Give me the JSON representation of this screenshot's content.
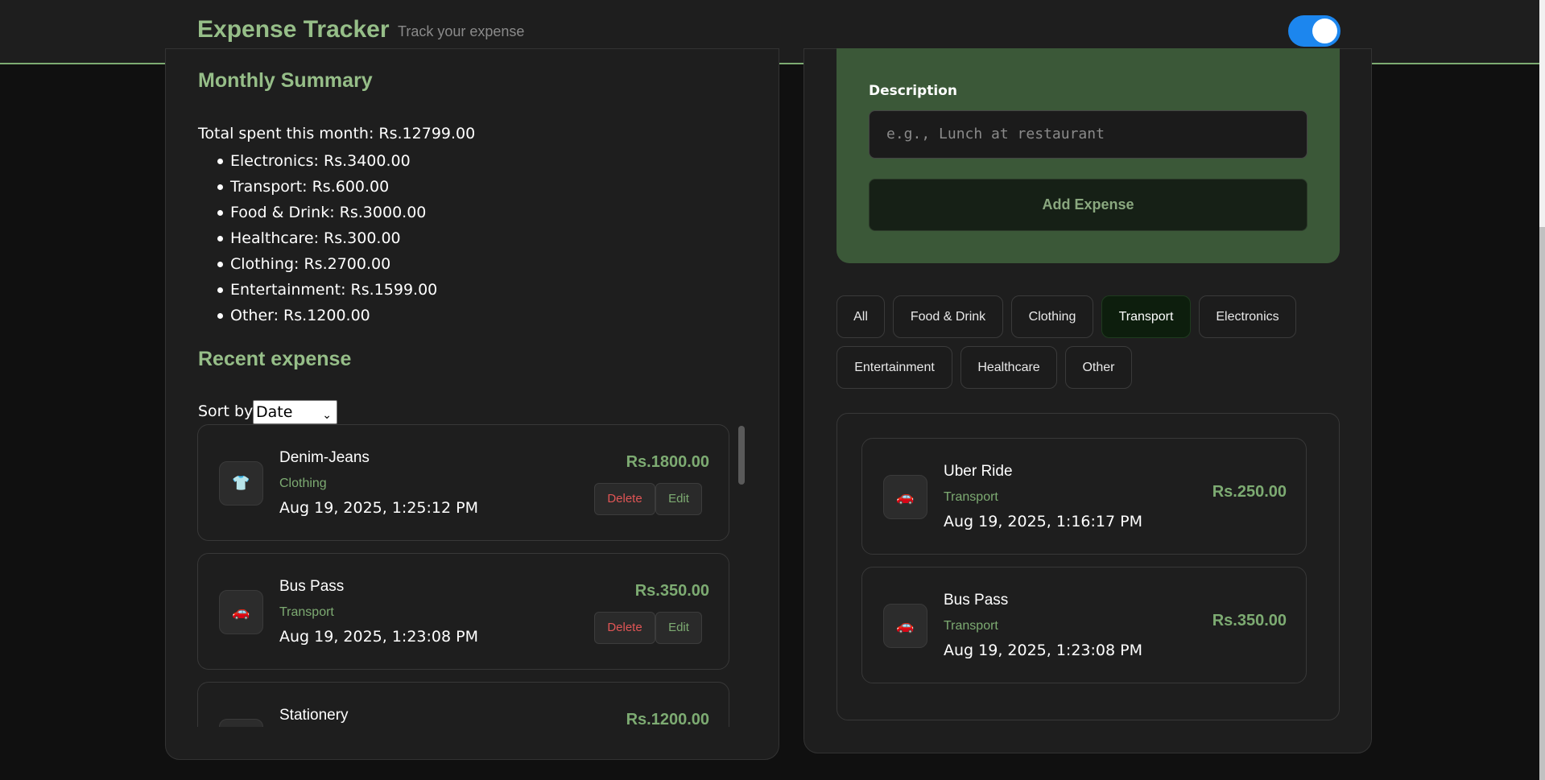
{
  "header": {
    "title": "Expense Tracker",
    "tagline": "Track your expense",
    "theme_toggle_on": true,
    "accent_color": "#96be88",
    "toggle_color": "#1c86ee"
  },
  "summary": {
    "title": "Monthly Summary",
    "total": "Total spent this month: Rs.12799.00",
    "categories": [
      "Electronics: Rs.3400.00",
      "Transport: Rs.600.00",
      "Food & Drink: Rs.3000.00",
      "Healthcare: Rs.300.00",
      "Clothing: Rs.2700.00",
      "Entertainment: Rs.1599.00",
      "Other: Rs.1200.00"
    ]
  },
  "recent": {
    "title": "Recent expense",
    "sort_label": "Sort by:",
    "sort_value": "Date",
    "delete_label": "Delete",
    "edit_label": "Edit",
    "items": [
      {
        "name": "Denim-Jeans",
        "category": "Clothing",
        "date": "Aug 19, 2025, 1:25:12 PM",
        "amount": "Rs.1800.00",
        "icon": "👕",
        "icon_name": "shirt-icon"
      },
      {
        "name": "Bus Pass",
        "category": "Transport",
        "date": "Aug 19, 2025, 1:23:08 PM",
        "amount": "Rs.350.00",
        "icon": "🚗",
        "icon_name": "car-icon"
      },
      {
        "name": "Stationery",
        "category": "",
        "date": "",
        "amount": "Rs.1200.00",
        "icon": "",
        "icon_name": "other-icon"
      }
    ]
  },
  "form": {
    "description_label": "Description",
    "description_placeholder": "e.g., Lunch at restaurant",
    "add_button": "Add Expense"
  },
  "filters": {
    "options": [
      "All",
      "Food & Drink",
      "Clothing",
      "Transport",
      "Electronics",
      "Entertainment",
      "Healthcare",
      "Other"
    ],
    "active": "Transport"
  },
  "filtered": {
    "items": [
      {
        "name": "Uber Ride",
        "category": "Transport",
        "date": "Aug 19, 2025, 1:16:17 PM",
        "amount": "Rs.250.00",
        "icon": "🚗",
        "icon_name": "car-icon"
      },
      {
        "name": "Bus Pass",
        "category": "Transport",
        "date": "Aug 19, 2025, 1:23:08 PM",
        "amount": "Rs.350.00",
        "icon": "🚗",
        "icon_name": "car-icon"
      }
    ]
  }
}
